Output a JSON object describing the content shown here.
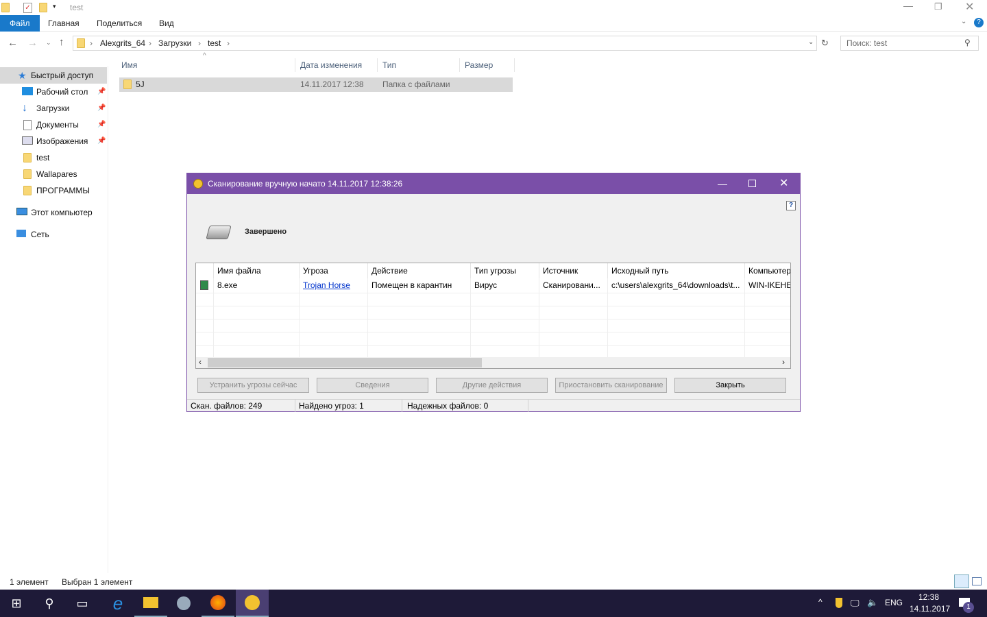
{
  "explorer": {
    "title": "test",
    "ribbon_tabs": [
      "Файл",
      "Главная",
      "Поделиться",
      "Вид"
    ],
    "breadcrumb": [
      "Alexgrits_64",
      "Загрузки",
      "test"
    ],
    "search_placeholder": "Поиск: test",
    "nav": [
      {
        "label": "Быстрый доступ",
        "icon": "star-icon"
      },
      {
        "label": "Рабочий стол",
        "icon": "desktop-icon",
        "pinned": true
      },
      {
        "label": "Загрузки",
        "icon": "download-icon",
        "pinned": true
      },
      {
        "label": "Документы",
        "icon": "document-icon",
        "pinned": true
      },
      {
        "label": "Изображения",
        "icon": "image-icon",
        "pinned": true
      },
      {
        "label": "test",
        "icon": "folder-icon"
      },
      {
        "label": "Wallapares",
        "icon": "folder-icon"
      },
      {
        "label": "ПРОГРАММЫ",
        "icon": "folder-icon"
      },
      {
        "label": "Этот компьютер",
        "icon": "computer-icon"
      },
      {
        "label": "Сеть",
        "icon": "network-icon"
      }
    ],
    "columns": [
      "Имя",
      "Дата изменения",
      "Тип",
      "Размер"
    ],
    "files": [
      {
        "name": "5J",
        "date": "14.11.2017 12:38",
        "type": "Папка с файлами",
        "size": ""
      }
    ],
    "status_count": "1 элемент",
    "status_selected": "Выбран 1 элемент"
  },
  "dialog": {
    "title": "Сканирование вручную начато 14.11.2017 12:38:26",
    "status": "Завершено",
    "columns": [
      "Имя файла",
      "Угроза",
      "Действие",
      "Тип угрозы",
      "Источник",
      "Исходный путь",
      "Компьютер"
    ],
    "rows": [
      [
        "8.exe",
        "Trojan Horse",
        "Помещен в карантин",
        "Вирус",
        "Сканировани...",
        "c:\\users\\alexgrits_64\\downloads\\t...",
        "WIN-IKEHE"
      ]
    ],
    "buttons": [
      "Устранить угрозы сейчас",
      "Сведения",
      "Другие действия",
      "Приостановить сканирование",
      "Закрыть"
    ],
    "status_bar": [
      "Скан. файлов: 249",
      "Найдено угроз: 1",
      "Надежных файлов: 0"
    ],
    "accent": "#7a4fa8"
  },
  "taskbar": {
    "lang": "ENG",
    "time": "12:38",
    "date": "14.11.2017",
    "notifications": "1"
  }
}
